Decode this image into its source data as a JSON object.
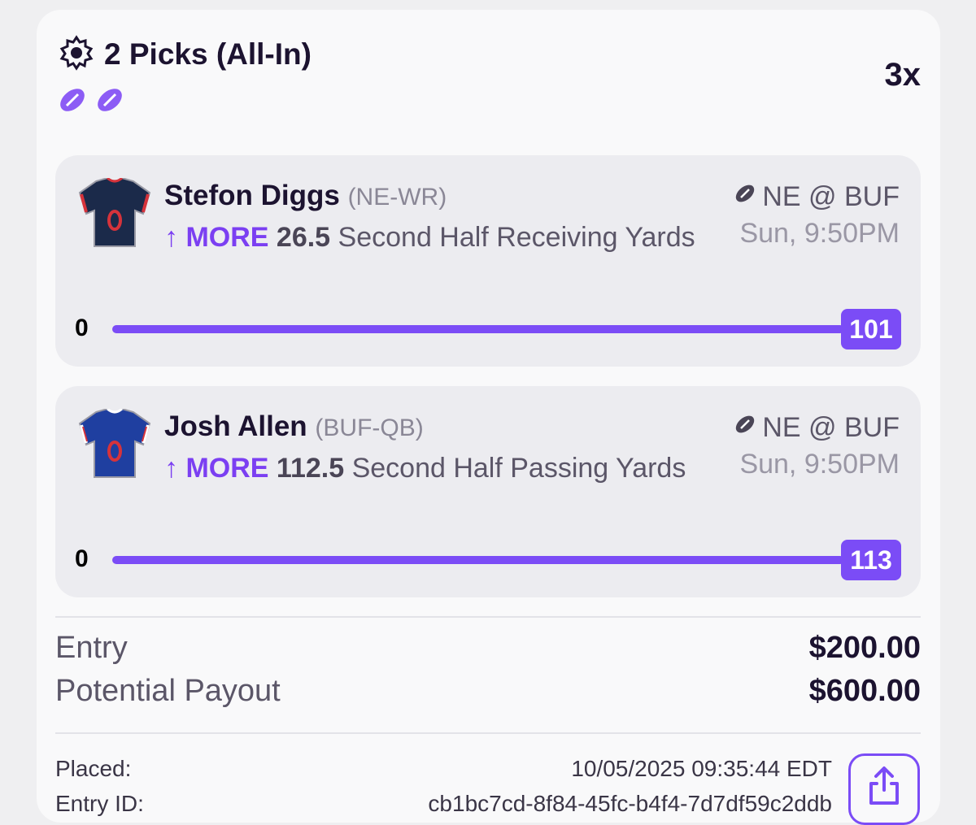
{
  "header": {
    "title": "2 Picks (All-In)",
    "multiplier": "3x",
    "sport_icons": [
      "football-icon",
      "football-icon"
    ]
  },
  "picks": [
    {
      "player": "Stefon Diggs",
      "position": "(NE-WR)",
      "direction": "MORE",
      "line": "26.5",
      "stat": "Second Half Receiving Yards",
      "matchup": "NE @ BUF",
      "time": "Sun, 9:50PM",
      "progress_min": "0",
      "progress_value": "101",
      "jersey_color": "#1b2a4a"
    },
    {
      "player": "Josh Allen",
      "position": "(BUF-QB)",
      "direction": "MORE",
      "line": "112.5",
      "stat": "Second Half Passing Yards",
      "matchup": "NE @ BUF",
      "time": "Sun, 9:50PM",
      "progress_min": "0",
      "progress_value": "113",
      "jersey_color": "#1f3fa0"
    }
  ],
  "summary": {
    "entry_label": "Entry",
    "entry_value": "$200.00",
    "payout_label": "Potential Payout",
    "payout_value": "$600.00"
  },
  "details": {
    "placed_label": "Placed:",
    "placed_value": "10/05/2025 09:35:44 EDT",
    "entry_id_label": "Entry ID:",
    "entry_id_value": "cb1bc7cd-8f84-45fc-b4f4-7d7df59c2ddb"
  },
  "colors": {
    "accent": "#7b4cf6",
    "text": "#1c1330",
    "muted": "#5b5668"
  }
}
